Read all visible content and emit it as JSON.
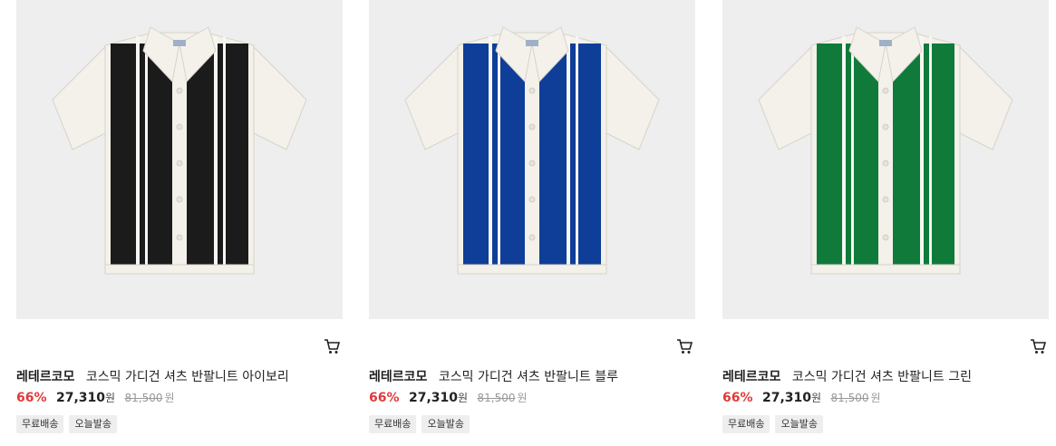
{
  "products": [
    {
      "brand": "레테르코모",
      "name": "코스믹 가디건 셔츠 반팔니트 아이보리",
      "discount": "66%",
      "price": "27,310",
      "currency": "원",
      "original_price": "81,500",
      "original_currency": "원",
      "badges": [
        "무료배송",
        "오늘발송"
      ],
      "panel_color": "#1b1b1b",
      "image_alt": "ivory knit shirt"
    },
    {
      "brand": "레테르코모",
      "name": "코스믹 가디건 셔츠 반팔니트 블루",
      "discount": "66%",
      "price": "27,310",
      "currency": "원",
      "original_price": "81,500",
      "original_currency": "원",
      "badges": [
        "무료배송",
        "오늘발송"
      ],
      "panel_color": "#0f3e98",
      "image_alt": "blue knit shirt"
    },
    {
      "brand": "레테르코모",
      "name": "코스믹 가디건 셔츠 반팔니트 그린",
      "discount": "66%",
      "price": "27,310",
      "currency": "원",
      "original_price": "81,500",
      "original_currency": "원",
      "badges": [
        "무료배송",
        "오늘발송"
      ],
      "panel_color": "#0f7a3a",
      "image_alt": "green knit shirt"
    }
  ],
  "icons": {
    "cart": "cart-icon"
  },
  "colors": {
    "discount": "#e03a3a",
    "badge_bg": "#eeeeee",
    "image_bg": "#eeeeee",
    "shirt_body": "#f3f1ea"
  }
}
